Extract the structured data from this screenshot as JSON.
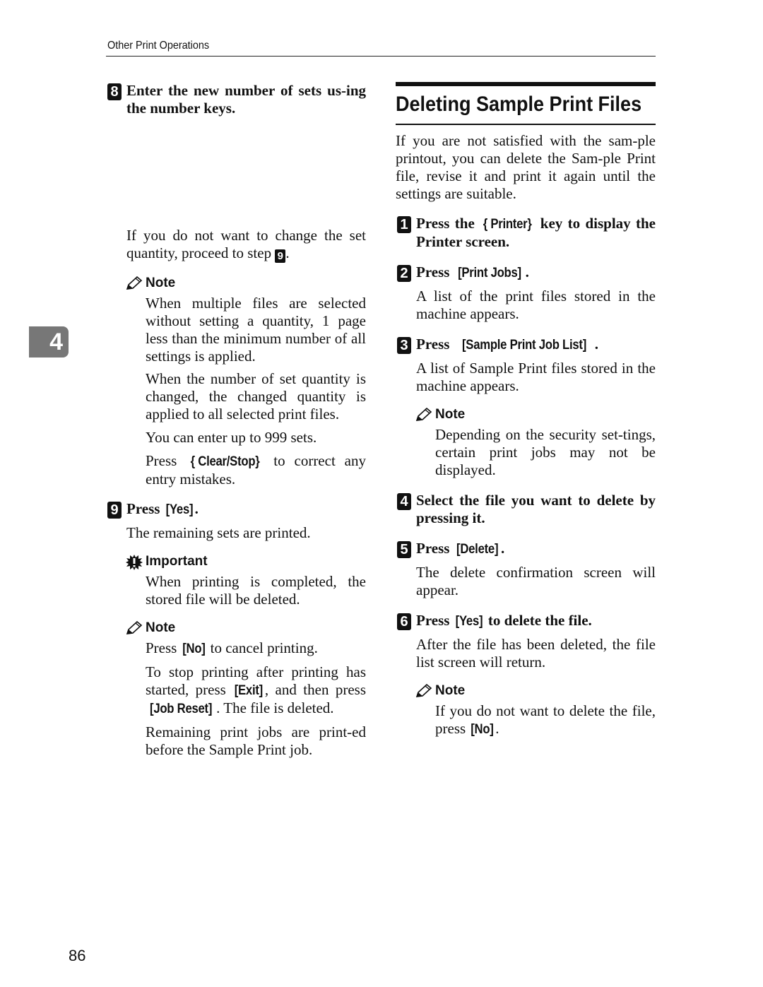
{
  "header": {
    "running_head": "Other Print Operations"
  },
  "chapter_tab": {
    "number": "4"
  },
  "page_number": "86",
  "left_column": {
    "step8": {
      "number": "8",
      "text": "Enter the new number of sets us-ing the number keys.",
      "body_pre": "If you do not want to change the set quantity, proceed to step ",
      "body_step_ref": "9",
      "body_post": ".",
      "note": {
        "title": "Note",
        "paras": [
          "When multiple files are selected without setting a quantity, 1 page less than the minimum number of all settings is applied.",
          "When the number of set quantity is changed, the changed quantity is applied to all selected print files.",
          "You can enter up to 999 sets."
        ],
        "clear_pre": "Press ",
        "clear_key": "{ Clear/Stop}",
        "clear_post": " to correct any entry mistakes."
      }
    },
    "step9": {
      "number": "9",
      "text_pre": "Press ",
      "text_key": "[Yes]",
      "text_post": ".",
      "body": "The remaining sets are printed.",
      "important": {
        "title": "Important",
        "paras": [
          "When printing is completed, the stored file will be deleted."
        ]
      },
      "note": {
        "title": "Note",
        "p1_pre": "Press ",
        "p1_key": "[No]",
        "p1_post": " to cancel printing.",
        "p2_pre": "To stop printing after printing has started, press ",
        "p2_key1": "[Exit]",
        "p2_mid": ", and then press ",
        "p2_key2": "[Job Reset]",
        "p2_post": ". The file is deleted.",
        "p3": "Remaining print jobs are print-ed before the Sample Print job."
      }
    }
  },
  "right_column": {
    "section_title": "Deleting Sample Print Files",
    "intro": "If you are not satisfied with the sam-ple printout, you can delete the Sam-ple Print file, revise it and print it again until the settings are suitable.",
    "steps": [
      {
        "number": "1",
        "pre": "Press the ",
        "key": "{ Printer}",
        "post": " key to display the Printer screen."
      },
      {
        "number": "2",
        "pre": "Press ",
        "key": "[Print Jobs]",
        "post": ".",
        "body": "A list of the print files stored in the machine appears."
      },
      {
        "number": "3",
        "pre": "Press ",
        "key": "[Sample Print Job List]",
        "post": ".",
        "body": "A list of Sample Print files stored in the machine appears.",
        "note": {
          "title": "Note",
          "text": "Depending on the security set-tings, certain print jobs may not be displayed."
        }
      },
      {
        "number": "4",
        "pre": "Select the file you want to delete by pressing it."
      },
      {
        "number": "5",
        "pre": "Press ",
        "key": "[Delete]",
        "post": ".",
        "body": "The delete confirmation screen will appear."
      },
      {
        "number": "6",
        "pre": "Press ",
        "key": "[Yes]",
        "post": " to delete the file.",
        "body": "After the file has been deleted, the file list screen will return.",
        "note": {
          "title": "Note",
          "pre": "If you do not want to delete the file, press ",
          "key": "[No]",
          "post": "."
        }
      }
    ]
  }
}
